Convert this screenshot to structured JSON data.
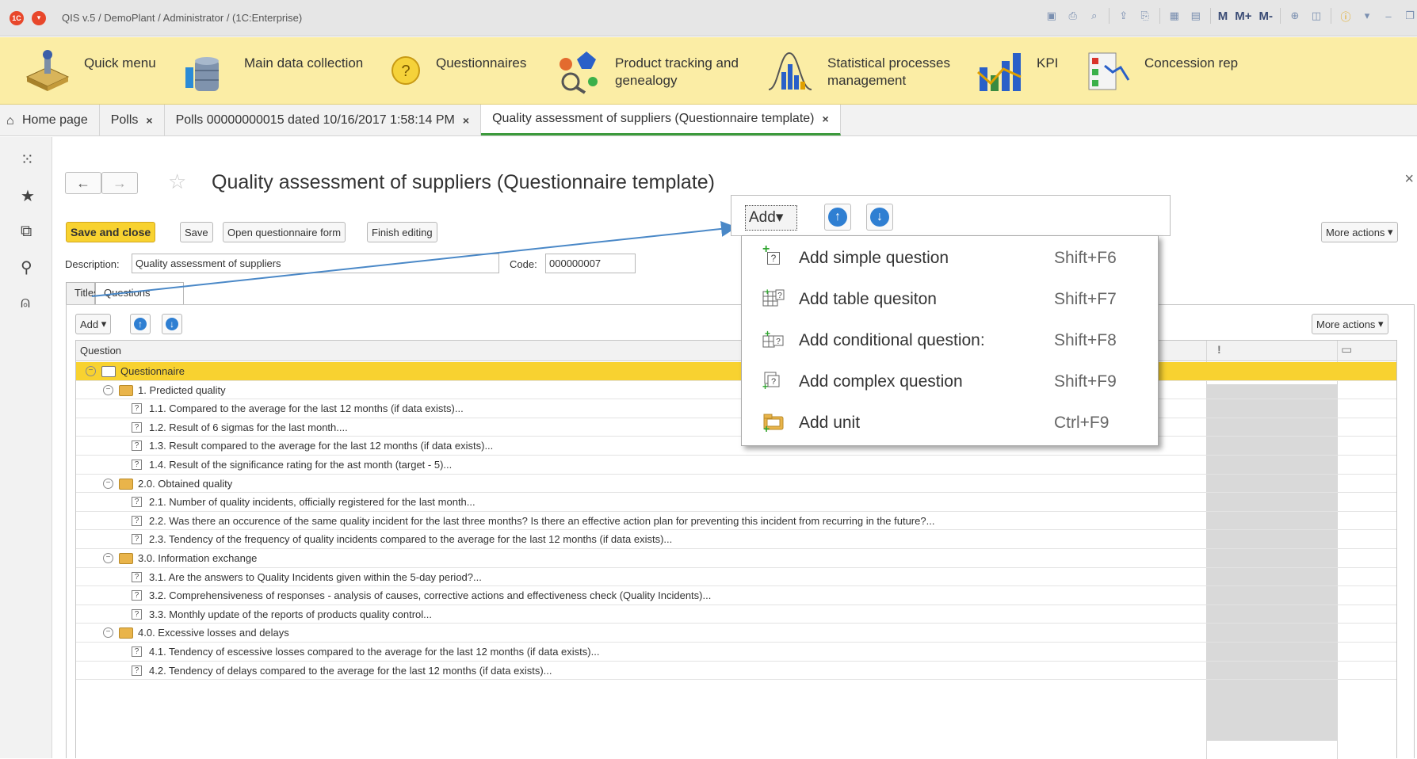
{
  "window": {
    "title": "QIS v.5 / DemoPlant / Administrator /  (1C:Enterprise)",
    "memory_buttons": [
      "M",
      "M+",
      "M-"
    ]
  },
  "sections": [
    {
      "label": "Quick menu",
      "icon": "quick-menu-icon"
    },
    {
      "label": "Main data collection",
      "icon": "database-icon"
    },
    {
      "label": "Questionnaires",
      "icon": "question-icon"
    },
    {
      "label": "Product tracking  and genealogy",
      "icon": "genealogy-icon"
    },
    {
      "label": "Statistical processes management",
      "icon": "statistics-icon"
    },
    {
      "label": "KPI",
      "icon": "kpi-chart-icon"
    },
    {
      "label": "Concession rep",
      "icon": "concession-icon"
    }
  ],
  "tabs": [
    {
      "label": "Home page"
    },
    {
      "label": "Polls"
    },
    {
      "label": "Polls 00000000015 dated 10/16/2017 1:58:14 PM"
    },
    {
      "label": "Quality assessment of suppliers (Questionnaire template)"
    }
  ],
  "form": {
    "title": "Quality assessment of suppliers (Questionnaire template)",
    "buttons": {
      "save_close": "Save and close",
      "save": "Save",
      "open_form": "Open questionnaire form",
      "finish_editing": "Finish editing",
      "more_actions": "More actions"
    },
    "description_label": "Description:",
    "description_value": "Quality assessment of suppliers",
    "code_label": "Code:",
    "code_value": "000000007",
    "tabs": [
      "Titles",
      "Questions"
    ],
    "add_label": "Add",
    "more_actions_inner": "More actions"
  },
  "grid": {
    "column_question": "Question",
    "column_mandatory_icon": "exclamation-icon",
    "column_comment_icon": "comment-icon",
    "rows": [
      {
        "level": 0,
        "type": "root",
        "text": "Questionnaire"
      },
      {
        "level": 1,
        "type": "unit",
        "text": "1. Predicted quality"
      },
      {
        "level": 2,
        "type": "question",
        "text": "1.1. Compared to the average for the last 12 months (if data exists)..."
      },
      {
        "level": 2,
        "type": "question",
        "text": "1.2. Result of 6 sigmas for the last month...."
      },
      {
        "level": 2,
        "type": "question",
        "text": "1.3. Result compared to the average for the last 12 months (if data exists)..."
      },
      {
        "level": 2,
        "type": "question",
        "text": "1.4. Result of the significance rating for the ast month (target - 5)..."
      },
      {
        "level": 1,
        "type": "unit",
        "text": "2.0. Obtained quality"
      },
      {
        "level": 2,
        "type": "question",
        "text": "2.1. Number of quality incidents, officially registered for the last month..."
      },
      {
        "level": 2,
        "type": "question",
        "text": "2.2. Was there an occurence of the same quality incident for the last three months? Is there an effective action plan for preventing this incident from recurring in the future?..."
      },
      {
        "level": 2,
        "type": "question",
        "text": "2.3. Tendency of the frequency of quality incidents compared to the average for the last 12 months (if data exists)..."
      },
      {
        "level": 1,
        "type": "unit",
        "text": "3.0. Information exchange"
      },
      {
        "level": 2,
        "type": "question",
        "text": "3.1. Are the answers to Quality Incidents given within the 5-day period?..."
      },
      {
        "level": 2,
        "type": "question",
        "text": "3.2. Comprehensiveness of responses - analysis of causes, corrective actions and effectiveness check (Quality Incidents)..."
      },
      {
        "level": 2,
        "type": "question",
        "text": "3.3. Monthly update of the reports of products quality control..."
      },
      {
        "level": 1,
        "type": "unit",
        "text": "4.0. Excessive losses and delays"
      },
      {
        "level": 2,
        "type": "question",
        "text": "4.1. Tendency of escessive losses compared to the average for the last 12 months (if data exists)..."
      },
      {
        "level": 2,
        "type": "question",
        "text": "4.2. Tendency of delays compared to the average for the last 12 months (if data exists)..."
      }
    ]
  },
  "popup": {
    "add_label": "Add",
    "items": [
      {
        "label": "Add simple question",
        "shortcut": "Shift+F6",
        "icon": "add-simple-question-icon"
      },
      {
        "label": "Add table quesiton",
        "shortcut": "Shift+F7",
        "icon": "add-table-question-icon"
      },
      {
        "label": "Add conditional question:",
        "shortcut": "Shift+F8",
        "icon": "add-conditional-question-icon"
      },
      {
        "label": "Add complex question",
        "shortcut": "Shift+F9",
        "icon": "add-complex-question-icon"
      },
      {
        "label": "Add unit",
        "shortcut": "Ctrl+F9",
        "icon": "add-unit-icon"
      }
    ]
  },
  "colors": {
    "accent_yellow": "#f8d230",
    "sections_bg": "#fbeda5",
    "arrow_blue": "#2f7fd2",
    "active_tab_underline": "#3c9a3c",
    "callout_line": "#4a88c7"
  }
}
